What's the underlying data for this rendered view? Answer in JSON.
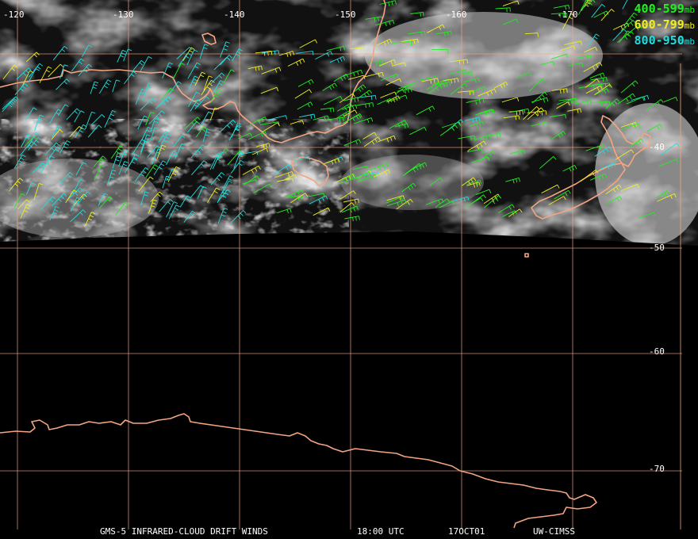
{
  "map": {
    "longitude_labels": [
      "-120",
      "-130",
      "-140",
      "-150",
      "-160",
      "-170"
    ],
    "latitude_labels": [
      "-40",
      "-50",
      "-60",
      "-70"
    ],
    "colors": {
      "coastline": "#f4a582",
      "grid": "#f4a582",
      "level_400_599": "#22ee22",
      "level_600_799": "#eeee22",
      "level_800_950": "#22dddd"
    }
  },
  "legend": [
    {
      "range": "400-599",
      "unit": "mb",
      "color": "#22ee22"
    },
    {
      "range": "600-799",
      "unit": "mb",
      "color": "#eeee22"
    },
    {
      "range": "800-950",
      "unit": "mb",
      "color": "#22dddd"
    }
  ],
  "footer": {
    "product": "GMS-5 INFRARED-CLOUD DRIFT WINDS",
    "time": "18:00 UTC",
    "date": "17OCT01",
    "source": "UW-CIMSS"
  }
}
